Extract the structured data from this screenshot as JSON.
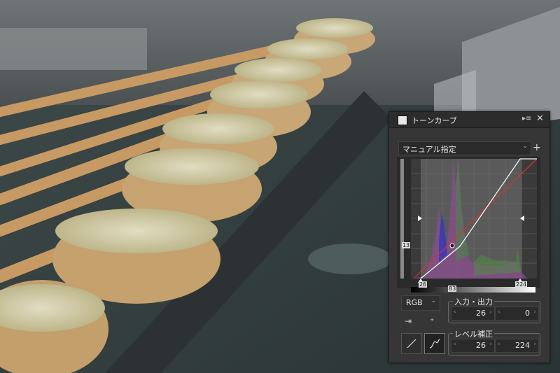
{
  "panel": {
    "title": "トーンカーブ",
    "menu_icon": "▸≡",
    "close_icon": "✕",
    "preset": "マニュアル指定",
    "add_icon": "+",
    "channel": "RGB",
    "point_marker": "13",
    "input_marker": "26",
    "mid_marker": "83",
    "output_marker": "224",
    "io": {
      "label": "入力・出力",
      "input": "26",
      "output": "0"
    },
    "level": {
      "label": "レベル補正",
      "low": "26",
      "high": "224"
    },
    "modes": [
      "line-mode-icon",
      "curve-mode-icon"
    ]
  }
}
